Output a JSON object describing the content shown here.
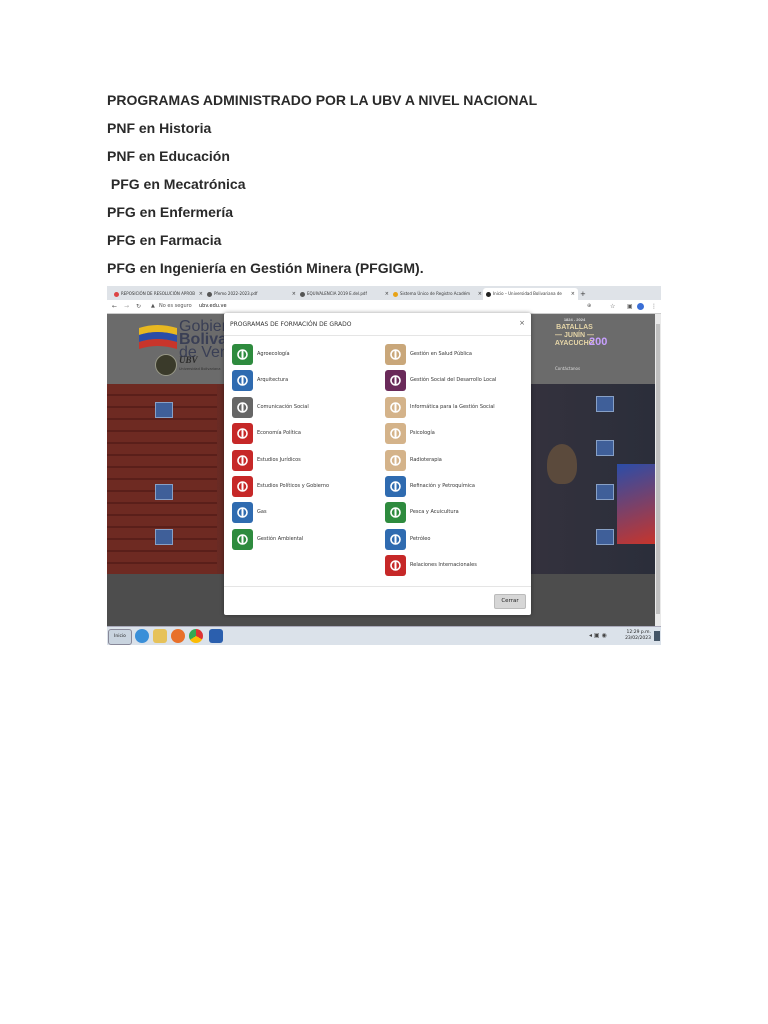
{
  "document": {
    "lines": [
      "PROGRAMAS ADMINISTRADO POR LA UBV A NIVEL NACIONAL",
      "PNF en Historia",
      "PNF en Educación",
      " PFG en Mecatrónica",
      "PFG en Enfermería",
      "PFG en Farmacia",
      "PFG en Ingeniería en Gestión Minera (PFGIGM)."
    ]
  },
  "browser": {
    "tabs": [
      "REPOSICIÓN DE RESOLUCIÓN APROB",
      "Pfemo 2022-2023.pdf",
      "EQUIVALENCIA 2019 E.del.pdf",
      "Sistema Único de Registro Académ",
      "Inicio – Universidad Bolivariana de"
    ],
    "address_warning": "No es seguro",
    "url": "ubv.edu.ve"
  },
  "site": {
    "gobierno_line1": "Gobiern",
    "gobierno_line2": "Bolivar",
    "gobierno_line3": "de Vene",
    "ubv_label": "UBV",
    "ubv_sub": "Universidad Bolivariana",
    "battle_years": "1824 - 2024",
    "battle_word": "BATALLAS",
    "battle_junin": "— JUNÍN —",
    "battle_ayacucho": "AYACUCHO",
    "battle_200": "200",
    "nav_hint": "Contáctanos"
  },
  "modal": {
    "title": "PROGRAMAS DE FORMACIÓN DE GRADO",
    "close": "×",
    "left": [
      {
        "label": "Agroecología",
        "icon": "plant-icon",
        "color": "#2e8b3e"
      },
      {
        "label": "Arquitectura",
        "icon": "house-icon",
        "color": "#2f6bb0"
      },
      {
        "label": "Comunicación Social",
        "icon": "camera-icon",
        "color": "#666666"
      },
      {
        "label": "Economía Política",
        "icon": "chart-icon",
        "color": "#c62828"
      },
      {
        "label": "Estudios Jurídicos",
        "icon": "gavel-icon",
        "color": "#c62828"
      },
      {
        "label": "Estudios Políticos y Gobierno",
        "icon": "globe-icon",
        "color": "#c62828"
      },
      {
        "label": "Gas",
        "icon": "factory-icon",
        "color": "#2f6bb0"
      },
      {
        "label": "Gestión Ambiental",
        "icon": "recycle-icon",
        "color": "#2e8b3e"
      }
    ],
    "right": [
      {
        "label": "Gestión en Salud Pública",
        "icon": "health-icon",
        "color": "#c9a77a"
      },
      {
        "label": "Gestión Social del Desarrollo Local",
        "icon": "network-icon",
        "color": "#6a2a5a"
      },
      {
        "label": "Informática para la Gestión Social",
        "icon": "computer-icon",
        "color": "#d4b38a"
      },
      {
        "label": "Psicología",
        "icon": "head-icon",
        "color": "#d4b38a"
      },
      {
        "label": "Radioterapia",
        "icon": "radiation-icon",
        "color": "#d4b38a"
      },
      {
        "label": "Refinación y Petroquímica",
        "icon": "refinery-icon",
        "color": "#2f6bb0"
      },
      {
        "label": "Pesca y Acuicultura",
        "icon": "fish-icon",
        "color": "#2e8b3e"
      },
      {
        "label": "Petróleo",
        "icon": "oil-pump-icon",
        "color": "#2f6bb0"
      },
      {
        "label": "Relaciones Internacionales",
        "icon": "world-icon",
        "color": "#c62828"
      }
    ],
    "button": "Cerrar"
  },
  "taskbar": {
    "start": "Inicio",
    "time": "12:29 p.m.",
    "date": "23/02/2023"
  }
}
